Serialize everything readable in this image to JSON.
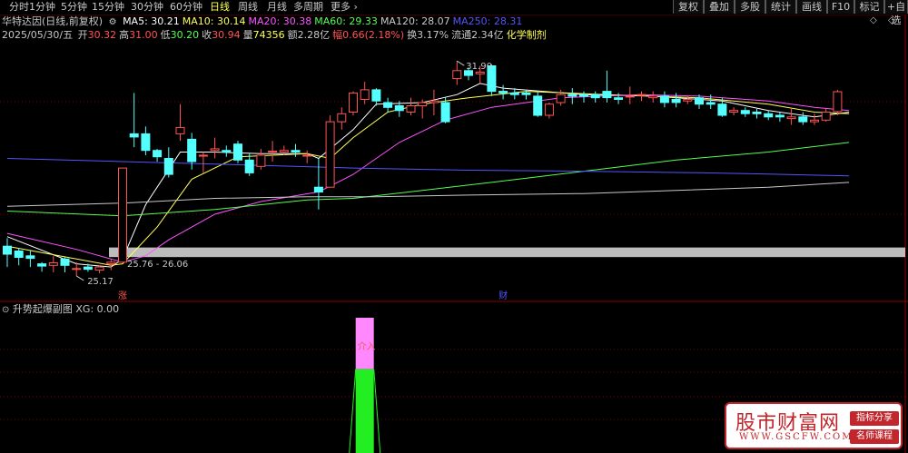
{
  "tabs": [
    {
      "label": "分时",
      "x": 10
    },
    {
      "label": "1分钟",
      "x": 32
    },
    {
      "label": "5分钟",
      "x": 67
    },
    {
      "label": "15分钟",
      "x": 101
    },
    {
      "label": "30分钟",
      "x": 144
    },
    {
      "label": "60分钟",
      "x": 187
    },
    {
      "label": "日线",
      "x": 231,
      "active": true
    },
    {
      "label": "周线",
      "x": 262
    },
    {
      "label": "月线",
      "x": 294
    },
    {
      "label": "多周期",
      "x": 323
    },
    {
      "label": "更多",
      "x": 364,
      "arrow": "chevron-right-icon"
    }
  ],
  "right_buttons": [
    {
      "label": "复权",
      "x": 741,
      "w": 34
    },
    {
      "label": "叠加",
      "x": 775,
      "w": 34
    },
    {
      "label": "多股",
      "x": 809,
      "w": 34
    },
    {
      "label": "统计",
      "x": 843,
      "w": 34
    },
    {
      "label": "画线",
      "x": 877,
      "w": 34
    },
    {
      "label": "F10",
      "x": 911,
      "w": 30
    },
    {
      "label": "标记",
      "x": 941,
      "w": 33
    },
    {
      "label": "+自选",
      "x": 974,
      "w": 26
    }
  ],
  "info": {
    "stock": "华特达因(日线,前复权)",
    "ma_items": [
      {
        "label": "MA5: 30.21",
        "color": "#ffffff"
      },
      {
        "label": "MA10: 30.14",
        "color": "#ffff54"
      },
      {
        "label": "MA20: 30.38",
        "color": "#ff54ff"
      },
      {
        "label": "MA60: 29.33",
        "color": "#54ff54"
      },
      {
        "label": "MA120: 28.07",
        "color": "#c8c8c8"
      },
      {
        "label": "MA250: 28.31",
        "color": "#5454ff"
      }
    ],
    "date": "2025/05/30/五",
    "quote_items": [
      {
        "label": "开",
        "value": "30.32",
        "lcolor": "#c8c8c8",
        "vcolor": "#ff5454"
      },
      {
        "label": "高",
        "value": "31.00",
        "lcolor": "#c8c8c8",
        "vcolor": "#ff5454"
      },
      {
        "label": "低",
        "value": "30.20",
        "lcolor": "#c8c8c8",
        "vcolor": "#54ff54"
      },
      {
        "label": "收",
        "value": "30.94",
        "lcolor": "#c8c8c8",
        "vcolor": "#ff5454"
      },
      {
        "label": "量",
        "value": "74356",
        "lcolor": "#c8c8c8",
        "vcolor": "#ffff54"
      },
      {
        "label": "额",
        "value": "2.28亿",
        "lcolor": "#c8c8c8",
        "vcolor": "#c8c8c8"
      },
      {
        "label": "幅",
        "value": "0.66(2.18%)",
        "lcolor": "#ff5454",
        "vcolor": "#ff5454"
      },
      {
        "label": "换",
        "value": "3.17%",
        "lcolor": "#c8c8c8",
        "vcolor": "#c8c8c8"
      },
      {
        "label": "流通",
        "value": "2.34亿",
        "lcolor": "#c8c8c8",
        "vcolor": "#c8c8c8"
      },
      {
        "label": "",
        "value": "化学制剂",
        "lcolor": "#c8c8c8",
        "vcolor": "#ffff54"
      }
    ]
  },
  "chart_data": {
    "type": "candlestick",
    "y_range": [
      24.4,
      33.3
    ],
    "up_color": "#ff5454",
    "down_color": "#54ffff",
    "candles": [
      {
        "o": 26.1,
        "h": 26.35,
        "c": 25.85,
        "l": 25.45
      },
      {
        "o": 25.95,
        "h": 26.05,
        "c": 25.75,
        "l": 25.5
      },
      {
        "o": 25.8,
        "h": 25.95,
        "c": 25.72,
        "l": 25.45
      },
      {
        "o": 25.55,
        "h": 25.6,
        "c": 25.48,
        "l": 25.3
      },
      {
        "o": 25.5,
        "h": 25.8,
        "c": 25.58,
        "l": 25.28
      },
      {
        "o": 25.7,
        "h": 25.75,
        "c": 25.5,
        "l": 25.28
      },
      {
        "o": 25.4,
        "h": 25.6,
        "c": 25.4,
        "l": 25.17
      },
      {
        "o": 25.45,
        "h": 25.55,
        "c": 25.38,
        "l": 25.3
      },
      {
        "o": 25.35,
        "h": 25.5,
        "c": 25.45,
        "l": 25.25
      },
      {
        "o": 25.55,
        "h": 25.7,
        "c": 25.6,
        "l": 25.35
      },
      {
        "o": 25.6,
        "h": 28.55,
        "c": 28.55,
        "l": 25.6
      },
      {
        "o": 29.62,
        "h": 30.9,
        "c": 29.52,
        "l": 29.2
      },
      {
        "o": 29.62,
        "h": 29.85,
        "c": 29.1,
        "l": 28.95
      },
      {
        "o": 29.1,
        "h": 29.15,
        "c": 28.9,
        "l": 28.75
      },
      {
        "o": 28.85,
        "h": 29.2,
        "c": 28.35,
        "l": 28.25
      },
      {
        "o": 29.62,
        "h": 30.55,
        "c": 29.82,
        "l": 29.4
      },
      {
        "o": 29.45,
        "h": 29.65,
        "c": 28.75,
        "l": 28.5
      },
      {
        "o": 28.95,
        "h": 29.05,
        "c": 28.95,
        "l": 28.4
      },
      {
        "o": 29.1,
        "h": 29.5,
        "c": 29.15,
        "l": 28.85
      },
      {
        "o": 29.1,
        "h": 29.25,
        "c": 29.05,
        "l": 28.9
      },
      {
        "o": 29.3,
        "h": 29.4,
        "c": 28.8,
        "l": 28.7
      },
      {
        "o": 28.8,
        "h": 29.0,
        "c": 28.4,
        "l": 28.3
      },
      {
        "o": 28.6,
        "h": 29.15,
        "c": 28.95,
        "l": 28.5
      },
      {
        "o": 29.05,
        "h": 29.4,
        "c": 29.08,
        "l": 28.75
      },
      {
        "o": 29.05,
        "h": 29.25,
        "c": 29.1,
        "l": 28.95
      },
      {
        "o": 29.1,
        "h": 29.3,
        "c": 29.05,
        "l": 28.9
      },
      {
        "o": 28.95,
        "h": 29.1,
        "c": 28.95,
        "l": 28.7
      },
      {
        "o": 27.95,
        "h": 28.85,
        "c": 27.8,
        "l": 27.25
      },
      {
        "o": 27.95,
        "h": 30.2,
        "c": 30.0,
        "l": 27.95
      },
      {
        "o": 30.0,
        "h": 30.45,
        "c": 30.25,
        "l": 29.75
      },
      {
        "o": 30.3,
        "h": 30.95,
        "c": 30.9,
        "l": 30.2
      },
      {
        "o": 30.7,
        "h": 31.25,
        "c": 31.0,
        "l": 30.55
      },
      {
        "o": 31.0,
        "h": 31.05,
        "c": 30.65,
        "l": 30.5
      },
      {
        "o": 30.6,
        "h": 30.75,
        "c": 30.45,
        "l": 30.3
      },
      {
        "o": 30.5,
        "h": 30.65,
        "c": 30.35,
        "l": 30.15
      },
      {
        "o": 30.3,
        "h": 30.75,
        "c": 30.5,
        "l": 30.2
      },
      {
        "o": 30.5,
        "h": 30.7,
        "c": 30.6,
        "l": 30.1
      },
      {
        "o": 30.6,
        "h": 31.0,
        "c": 30.65,
        "l": 30.2
      },
      {
        "o": 30.6,
        "h": 30.75,
        "c": 30.0,
        "l": 29.95
      },
      {
        "o": 31.35,
        "h": 31.9,
        "c": 31.6,
        "l": 31.15
      },
      {
        "o": 31.6,
        "h": 31.7,
        "c": 31.45,
        "l": 31.3
      },
      {
        "o": 31.5,
        "h": 31.75,
        "c": 31.55,
        "l": 31.2
      },
      {
        "o": 31.75,
        "h": 31.8,
        "c": 30.95,
        "l": 30.8
      },
      {
        "o": 30.95,
        "h": 31.15,
        "c": 30.9,
        "l": 30.7
      },
      {
        "o": 30.9,
        "h": 31.05,
        "c": 30.85,
        "l": 30.7
      },
      {
        "o": 30.9,
        "h": 31.0,
        "c": 30.85,
        "l": 30.7
      },
      {
        "o": 30.8,
        "h": 30.95,
        "c": 30.2,
        "l": 30.15
      },
      {
        "o": 30.2,
        "h": 30.6,
        "c": 30.55,
        "l": 30.1
      },
      {
        "o": 30.6,
        "h": 31.0,
        "c": 30.85,
        "l": 30.5
      },
      {
        "o": 30.85,
        "h": 31.05,
        "c": 30.8,
        "l": 30.55
      },
      {
        "o": 30.85,
        "h": 30.95,
        "c": 30.8,
        "l": 30.6
      },
      {
        "o": 30.85,
        "h": 30.95,
        "c": 30.75,
        "l": 30.6
      },
      {
        "o": 30.95,
        "h": 31.6,
        "c": 30.75,
        "l": 30.6
      },
      {
        "o": 30.75,
        "h": 30.9,
        "c": 30.7,
        "l": 30.55
      },
      {
        "o": 30.8,
        "h": 31.1,
        "c": 30.8,
        "l": 30.55
      },
      {
        "o": 30.85,
        "h": 30.95,
        "c": 30.85,
        "l": 30.65
      },
      {
        "o": 30.75,
        "h": 30.95,
        "c": 30.8,
        "l": 30.6
      },
      {
        "o": 30.8,
        "h": 30.95,
        "c": 30.6,
        "l": 30.45
      },
      {
        "o": 30.7,
        "h": 30.9,
        "c": 30.6,
        "l": 30.45
      },
      {
        "o": 30.65,
        "h": 30.8,
        "c": 30.7,
        "l": 30.55
      },
      {
        "o": 30.75,
        "h": 30.85,
        "c": 30.55,
        "l": 30.4
      },
      {
        "o": 30.6,
        "h": 30.85,
        "c": 30.55,
        "l": 30.4
      },
      {
        "o": 30.55,
        "h": 30.75,
        "c": 30.2,
        "l": 30.15
      },
      {
        "o": 30.3,
        "h": 30.45,
        "c": 30.35,
        "l": 30.2
      },
      {
        "o": 30.35,
        "h": 30.45,
        "c": 30.25,
        "l": 30.15
      },
      {
        "o": 30.3,
        "h": 30.4,
        "c": 30.25,
        "l": 30.1
      },
      {
        "o": 30.25,
        "h": 30.35,
        "c": 30.15,
        "l": 30.05
      },
      {
        "o": 30.2,
        "h": 30.3,
        "c": 30.15,
        "l": 30.0
      },
      {
        "o": 30.1,
        "h": 30.4,
        "c": 30.15,
        "l": 29.9
      },
      {
        "o": 30.15,
        "h": 30.3,
        "c": 30.0,
        "l": 29.9
      },
      {
        "o": 30.0,
        "h": 30.25,
        "c": 30.05,
        "l": 29.9
      },
      {
        "o": 30.05,
        "h": 30.4,
        "c": 30.3,
        "l": 30.0
      },
      {
        "o": 30.32,
        "h": 31.0,
        "c": 30.94,
        "l": 30.2
      }
    ],
    "ma_lines": [
      {
        "name": "MA5",
        "color": "#ffffff",
        "points": [
          [
            0,
            26.4
          ],
          [
            6,
            25.55
          ],
          [
            9,
            25.45
          ],
          [
            10,
            25.7
          ],
          [
            12,
            27.4
          ],
          [
            14,
            28.5
          ],
          [
            15,
            29.05
          ],
          [
            18,
            29.05
          ],
          [
            22,
            29.0
          ],
          [
            26,
            29.0
          ],
          [
            27,
            28.85
          ],
          [
            30,
            29.75
          ],
          [
            32,
            30.55
          ],
          [
            36,
            30.6
          ],
          [
            39,
            30.85
          ],
          [
            41,
            31.2
          ],
          [
            43,
            31.05
          ],
          [
            50,
            30.85
          ],
          [
            56,
            30.8
          ],
          [
            62,
            30.65
          ],
          [
            66,
            30.35
          ],
          [
            70,
            30.15
          ],
          [
            73,
            30.3
          ]
        ]
      },
      {
        "name": "MA10",
        "color": "#ffff54",
        "points": [
          [
            0,
            26.1
          ],
          [
            9,
            25.5
          ],
          [
            10,
            25.55
          ],
          [
            13,
            26.7
          ],
          [
            16,
            28.2
          ],
          [
            20,
            28.9
          ],
          [
            26,
            29.0
          ],
          [
            28,
            28.85
          ],
          [
            30,
            29.5
          ],
          [
            33,
            30.3
          ],
          [
            36,
            30.55
          ],
          [
            40,
            30.75
          ],
          [
            45,
            30.95
          ],
          [
            52,
            30.85
          ],
          [
            60,
            30.75
          ],
          [
            66,
            30.55
          ],
          [
            70,
            30.3
          ],
          [
            73,
            30.25
          ]
        ]
      },
      {
        "name": "MA20",
        "color": "#ff54ff",
        "points": [
          [
            0,
            26.5
          ],
          [
            6,
            26.0
          ],
          [
            10,
            25.6
          ],
          [
            12,
            25.8
          ],
          [
            14,
            26.3
          ],
          [
            18,
            27.1
          ],
          [
            22,
            27.5
          ],
          [
            27,
            27.8
          ],
          [
            30,
            28.35
          ],
          [
            34,
            29.35
          ],
          [
            38,
            30.05
          ],
          [
            42,
            30.45
          ],
          [
            48,
            30.75
          ],
          [
            55,
            30.85
          ],
          [
            60,
            30.8
          ],
          [
            66,
            30.65
          ],
          [
            70,
            30.45
          ],
          [
            73,
            30.35
          ]
        ]
      },
      {
        "name": "MA60",
        "color": "#54ff54",
        "points": [
          [
            0,
            27.2
          ],
          [
            10,
            27.05
          ],
          [
            18,
            27.25
          ],
          [
            26,
            27.55
          ],
          [
            30,
            27.6
          ],
          [
            36,
            27.85
          ],
          [
            42,
            28.1
          ],
          [
            50,
            28.45
          ],
          [
            58,
            28.8
          ],
          [
            66,
            29.05
          ],
          [
            73,
            29.35
          ]
        ]
      },
      {
        "name": "MA120",
        "color": "#c8c8c8",
        "points": [
          [
            0,
            27.35
          ],
          [
            10,
            27.45
          ],
          [
            18,
            27.6
          ],
          [
            26,
            27.65
          ],
          [
            32,
            27.65
          ],
          [
            40,
            27.7
          ],
          [
            50,
            27.75
          ],
          [
            58,
            27.85
          ],
          [
            66,
            27.95
          ],
          [
            73,
            28.1
          ]
        ]
      },
      {
        "name": "MA250",
        "color": "#5454ff",
        "points": [
          [
            0,
            28.85
          ],
          [
            10,
            28.75
          ],
          [
            20,
            28.65
          ],
          [
            30,
            28.55
          ],
          [
            40,
            28.48
          ],
          [
            50,
            28.45
          ],
          [
            60,
            28.4
          ],
          [
            66,
            28.36
          ],
          [
            73,
            28.3
          ]
        ]
      }
    ],
    "annotations": [
      {
        "text": "31.90",
        "candle": 39,
        "price": 31.9,
        "type": "high"
      },
      {
        "text": "25.17",
        "candle": 6,
        "price": 25.17,
        "type": "low"
      },
      {
        "text": "25.76 - 26.06",
        "candle": 10,
        "price": 25.76,
        "type": "zone"
      }
    ],
    "support_band": {
      "low": 25.76,
      "high": 26.06,
      "color": "#bcbcbc"
    },
    "markers": [
      {
        "text": "涨",
        "candle": 10,
        "color": "#ff5454"
      },
      {
        "text": "财",
        "candle": 43,
        "color": "#5454ff"
      }
    ],
    "sub_indicator": {
      "label": "升势起爆副图 XG: 0.00",
      "bar_candle": 31,
      "magenta_range": [
        1.0,
        0.62
      ],
      "green_range": [
        0.62,
        0.0
      ],
      "text": "介入"
    }
  },
  "logo": {
    "main": "股市财富网",
    "url": "WWW.GSCFW.COM",
    "badge1": "指标分享",
    "badge2": "名师课程"
  }
}
